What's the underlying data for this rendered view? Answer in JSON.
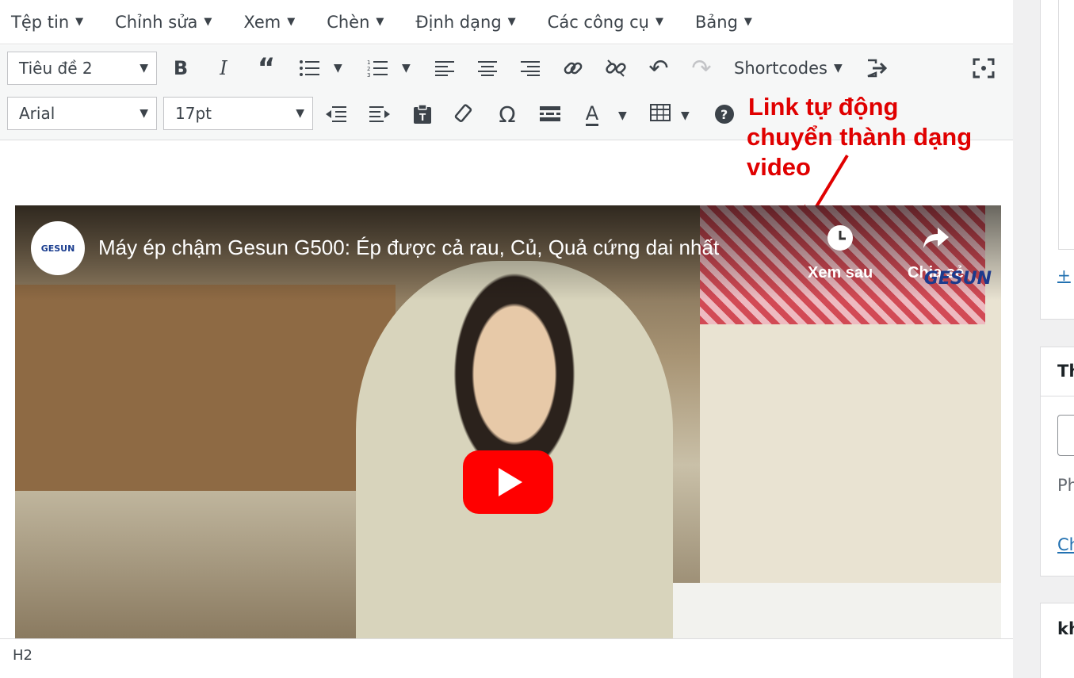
{
  "menubar": {
    "items": [
      {
        "label": "Tệp tin"
      },
      {
        "label": "Chỉnh sửa"
      },
      {
        "label": "Xem"
      },
      {
        "label": "Chèn"
      },
      {
        "label": "Định dạng"
      },
      {
        "label": "Các công cụ"
      },
      {
        "label": "Bảng"
      }
    ]
  },
  "toolbar1": {
    "format_select": "Tiêu đề 2",
    "shortcodes_label": "Shortcodes"
  },
  "toolbar2": {
    "font_select": "Arial",
    "size_select": "17pt",
    "text_color_glyph": "A"
  },
  "annotation": {
    "line1": "Link tự động",
    "line2": "chuyển thành dạng video"
  },
  "video": {
    "title": "Máy ép chậm Gesun G500: Ép được cả rau, Củ, Quả cứng dai nhất",
    "channel": "GESUN",
    "watch_later": "Xem sau",
    "share": "Chia sẻ",
    "watermark": "GESUN"
  },
  "statusbar": {
    "path": "H2"
  },
  "sidebar": {
    "add_link": "+",
    "heading1": "Th",
    "text1": "Ph",
    "link1": "Ch",
    "heading2": "kh"
  },
  "colors": {
    "annotation": "#e00000",
    "youtube_red": "#ff0000",
    "link": "#2271b1"
  }
}
